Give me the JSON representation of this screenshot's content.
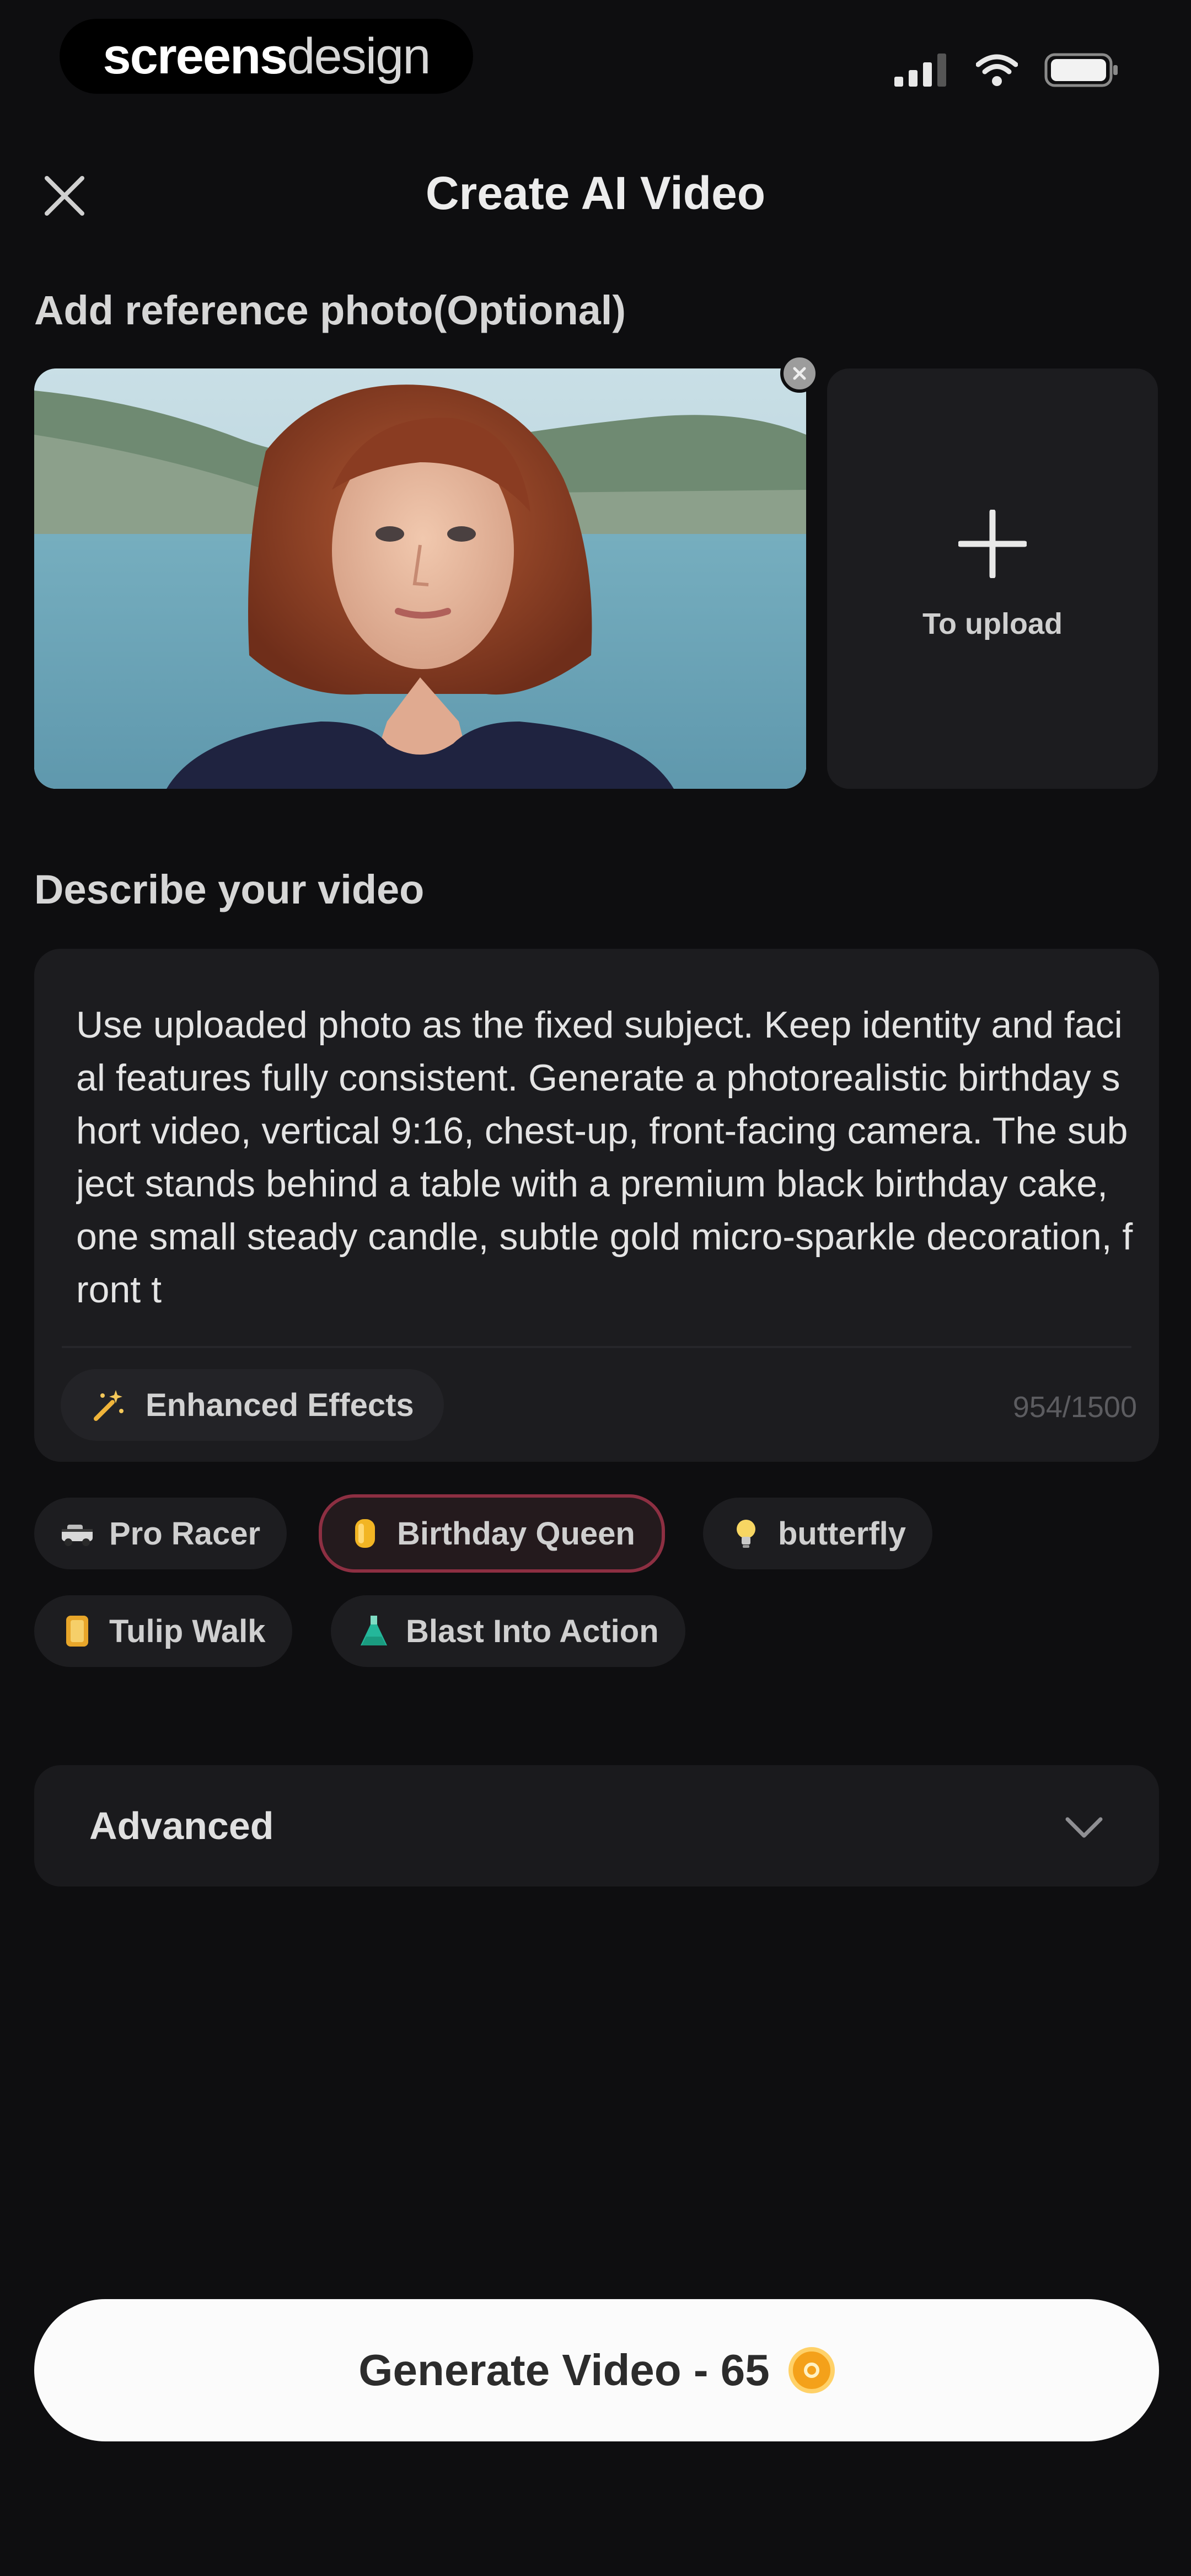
{
  "status_bar": {
    "brand_part1": "screens",
    "brand_part2": "design"
  },
  "header": {
    "title": "Create AI Video"
  },
  "reference": {
    "label": "Add reference photo(Optional)",
    "upload_label": "To upload"
  },
  "description": {
    "label": "Describe your video",
    "text": "Use uploaded photo as the fixed subject. Keep identity and facial features fully consistent. Generate a photorealistic birthday short video, vertical 9:16, chest-up, front-facing camera.  The subject stands behind a table with a premium black birthday cake, one small steady candle, subtle gold micro-sparkle decoration, front t",
    "enhanced_effects_label": "Enhanced Effects",
    "char_count": "954/1500"
  },
  "style_chips": [
    {
      "label": "Pro Racer",
      "icon": "race-car-icon",
      "selected": false
    },
    {
      "label": "Birthday Queen",
      "icon": "crown-icon",
      "selected": true
    },
    {
      "label": "butterfly",
      "icon": "bulb-icon",
      "selected": false
    },
    {
      "label": "Tulip Walk",
      "icon": "tulip-icon",
      "selected": false
    },
    {
      "label": "Blast Into Action",
      "icon": "flask-icon",
      "selected": false
    }
  ],
  "advanced": {
    "label": "Advanced"
  },
  "generate": {
    "label": "Generate Video - 65"
  },
  "colors": {
    "background": "#0e0e10",
    "card": "#1c1c1f",
    "selected_chip_border": "#8d2f42",
    "coin": "#f4a11a"
  }
}
